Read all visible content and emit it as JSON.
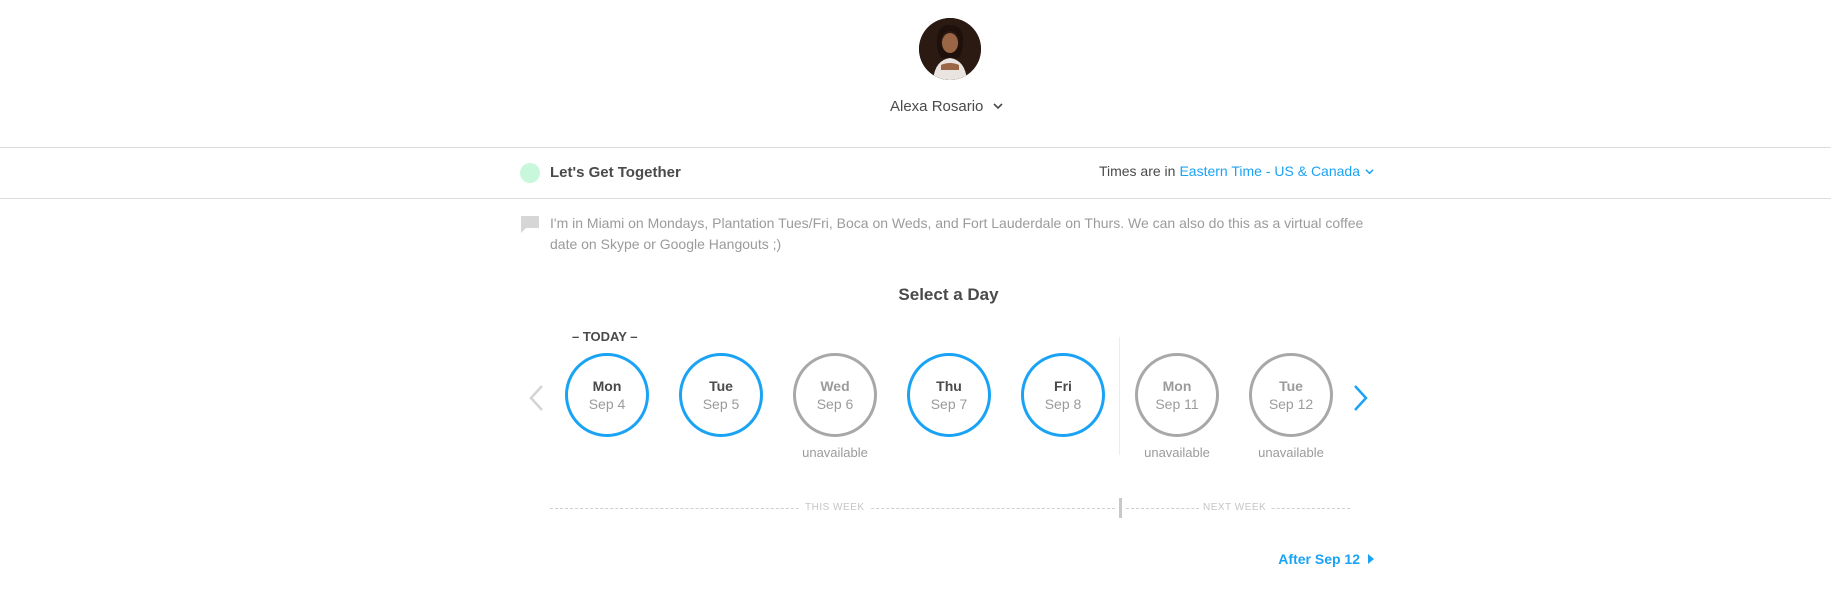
{
  "profile": {
    "name": "Alexa Rosario",
    "avatar_icon": "profile-photo"
  },
  "event": {
    "title": "Let's Get Together",
    "color": "#c8f7dc",
    "timezone_prefix": "Times are in",
    "timezone": "Eastern Time - US & Canada",
    "description": "I'm in Miami on Mondays, Plantation Tues/Fri, Boca on Weds, and Fort Lauderdale on Thurs. We can also do this as a virtual coffee date on Skype or Google Hangouts ;)"
  },
  "calendar": {
    "heading": "Select a Day",
    "today_label": "– TODAY –",
    "unavailable_label": "unavailable",
    "days": [
      {
        "name": "Mon",
        "date": "Sep 4",
        "available": true
      },
      {
        "name": "Tue",
        "date": "Sep 5",
        "available": true
      },
      {
        "name": "Wed",
        "date": "Sep 6",
        "available": false
      },
      {
        "name": "Thu",
        "date": "Sep 7",
        "available": true
      },
      {
        "name": "Fri",
        "date": "Sep 8",
        "available": true
      },
      {
        "name": "Mon",
        "date": "Sep 11",
        "available": false
      },
      {
        "name": "Tue",
        "date": "Sep 12",
        "available": false
      }
    ],
    "this_week_label": "THIS WEEK",
    "next_week_label": "NEXT WEEK",
    "after_label": "After Sep 12"
  },
  "colors": {
    "accent": "#1aa3f5",
    "unavailable": "#a8a8a8"
  }
}
